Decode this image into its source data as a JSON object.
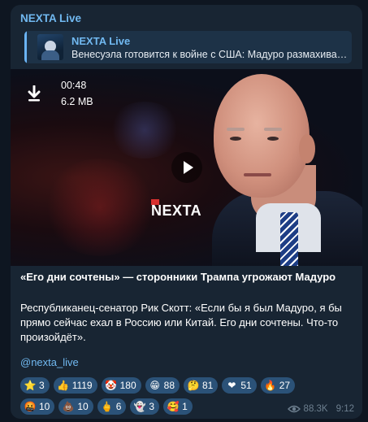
{
  "channel": {
    "name": "NEXTA Live"
  },
  "reply": {
    "title": "NEXTA Live",
    "text": "Венесуэла готовится к войне с США: Мадуро размахивает..."
  },
  "video": {
    "duration": "00:48",
    "size": "6.2 MB",
    "logo_text": "NEXTA"
  },
  "post": {
    "title": "«Его дни сочтены» — сторонники Трампа угрожают Мадуро",
    "body": "Республиканец-сенатор Рик Скотт: «Если бы я был Мадуро, я бы прямо сейчас ехал в Россию или Китай. Его дни сочтены. Что-то произойдёт».",
    "link": "@nexta_live"
  },
  "reactions": [
    [
      {
        "emoji": "⭐",
        "count": "3",
        "icon": "star-icon"
      },
      {
        "emoji": "👍",
        "count": "1119",
        "icon": "thumbs-up-icon"
      },
      {
        "emoji": "🤡",
        "count": "180",
        "icon": "clown-icon"
      },
      {
        "emoji": "😁",
        "count": "88",
        "icon": "grin-icon"
      },
      {
        "emoji": "🤔",
        "count": "81",
        "icon": "thinking-icon"
      },
      {
        "emoji": "❤",
        "count": "51",
        "icon": "heart-icon"
      },
      {
        "emoji": "🔥",
        "count": "27",
        "icon": "fire-icon"
      }
    ],
    [
      {
        "emoji": "🤬",
        "count": "10",
        "icon": "angry-icon"
      },
      {
        "emoji": "💩",
        "count": "10",
        "icon": "poop-icon"
      },
      {
        "emoji": "🖕",
        "count": "6",
        "icon": "middle-finger-icon"
      },
      {
        "emoji": "👻",
        "count": "3",
        "icon": "ghost-icon"
      },
      {
        "emoji": "🥰",
        "count": "1",
        "icon": "love-face-icon"
      }
    ]
  ],
  "meta": {
    "views": "88.3K",
    "time": "9:12"
  },
  "colors": {
    "accent": "#71b9f1",
    "bubble": "#182533",
    "background": "#0e1621",
    "reaction_bg": "#2b5278"
  }
}
